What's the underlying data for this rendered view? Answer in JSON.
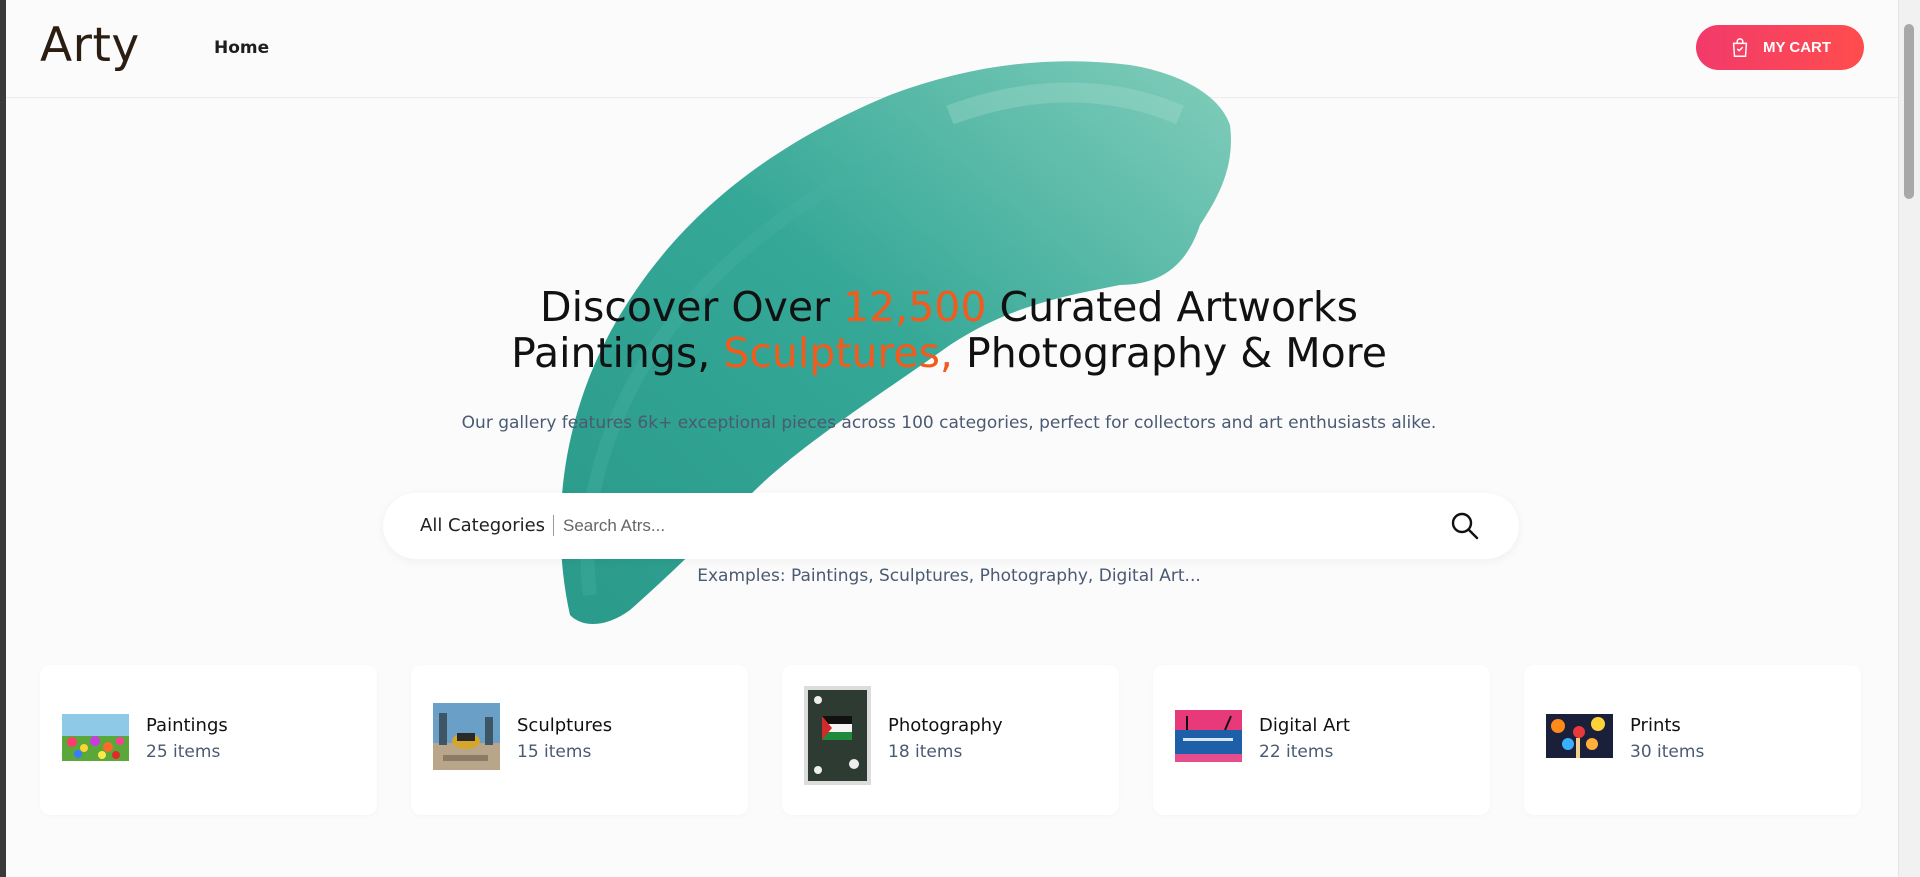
{
  "header": {
    "logo": "Arty",
    "nav": [
      {
        "label": "Home"
      }
    ],
    "cart_label": "MY CART"
  },
  "hero": {
    "line1_pre": "Discover Over ",
    "line1_accent": "12,500",
    "line1_post": " Curated Artworks",
    "line2_pre": "Paintings, ",
    "line2_accent": "Sculptures,",
    "line2_post": " Photography & More",
    "subtitle": "Our gallery features 6k+ exceptional pieces across 100 categories, perfect for collectors and art enthusiasts alike."
  },
  "search": {
    "category_label": "All Categories",
    "placeholder": "Search Atrs...",
    "examples": "Examples: Paintings, Sculptures, Photography, Digital Art..."
  },
  "categories": [
    {
      "name": "Paintings",
      "count": "25 items"
    },
    {
      "name": "Sculptures",
      "count": "15 items"
    },
    {
      "name": "Photography",
      "count": "18 items"
    },
    {
      "name": "Digital Art",
      "count": "22 items"
    },
    {
      "name": "Prints",
      "count": "30 items"
    }
  ],
  "colors": {
    "accent": "#f35a1c",
    "cart_gradient_start": "#f23a6b",
    "cart_gradient_end": "#ff4d4d",
    "brush": "#2a9d8f",
    "muted_text": "#4a5a72"
  },
  "icons": {
    "cart": "shopping-bag-icon",
    "search": "search-icon"
  }
}
